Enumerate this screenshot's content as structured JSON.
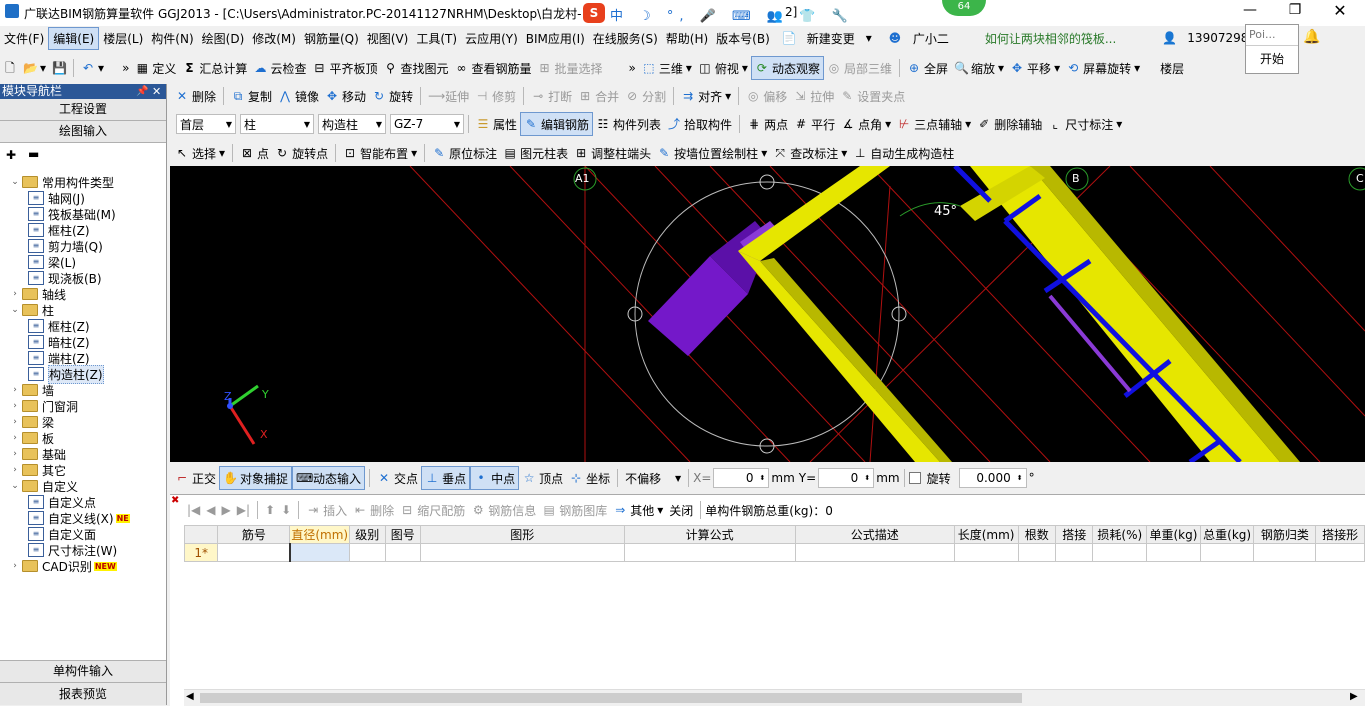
{
  "window": {
    "title": "广联达BIM钢筋算量软件 GGJ2013 - [C:\\Users\\Administrator.PC-20141127NRHM\\Desktop\\白龙村-",
    "title_tail": "2]",
    "ime_badge": "64",
    "popup_input": "Poi...",
    "popup_button": "开始"
  },
  "menu": {
    "items": [
      "文件(F)",
      "编辑(E)",
      "楼层(L)",
      "构件(N)",
      "绘图(D)",
      "修改(M)",
      "钢筋量(Q)",
      "视图(V)",
      "工具(T)",
      "云应用(Y)",
      "BIM应用(I)",
      "在线服务(S)",
      "帮助(H)",
      "版本号(B)"
    ],
    "new_change": "新建变更",
    "assistant": "广小二",
    "question": "如何让两块相邻的筏板...",
    "phone": "13907298339"
  },
  "toolbar1": {
    "define": "定义",
    "sum": "汇总计算",
    "cloud_check": "云检查",
    "flat_top": "平齐板顶",
    "find": "查找图元",
    "view_steel": "查看钢筋量",
    "batch_select": "批量选择",
    "three_d": "三维",
    "top_view": "俯视",
    "dynamic_view": "动态观察",
    "local_3d": "局部三维",
    "full_screen": "全屏",
    "zoom": "缩放",
    "pan": "平移",
    "rotate_screen": "屏幕旋转",
    "floor": "楼层"
  },
  "toolbar2": {
    "items": [
      "删除",
      "复制",
      "镜像",
      "移动",
      "旋转",
      "延伸",
      "修剪",
      "打断",
      "合并",
      "分割",
      "对齐",
      "偏移",
      "拉伸",
      "设置夹点"
    ]
  },
  "toolbar3": {
    "floor": "首层",
    "category": "柱",
    "type": "构造柱",
    "name": "GZ-7",
    "property": "属性",
    "edit_steel": "编辑钢筋",
    "component_list": "构件列表",
    "pick": "拾取构件",
    "two_point": "两点",
    "parallel": "平行",
    "point_angle": "点角",
    "three_point_axis": "三点辅轴",
    "delete_axis": "删除辅轴",
    "dimension": "尺寸标注"
  },
  "toolbar4": {
    "select": "选择",
    "point": "点",
    "rotate_point": "旋转点",
    "smart_layout": "智能布置",
    "origin_label": "原位标注",
    "column_table": "图元柱表",
    "adjust_end": "调整柱端头",
    "draw_by_wall": "按墙位置绘制柱",
    "modify_label": "查改标注",
    "auto_gen": "自动生成构造柱"
  },
  "nav": {
    "title": "模块导航栏",
    "project_setup": "工程设置",
    "drawing_input": "绘图输入",
    "tree": [
      {
        "label": "常用构件类型",
        "level": 0,
        "type": "folder",
        "exp": "-"
      },
      {
        "label": "轴网(J)",
        "level": 1,
        "type": "item"
      },
      {
        "label": "筏板基础(M)",
        "level": 1,
        "type": "item"
      },
      {
        "label": "框柱(Z)",
        "level": 1,
        "type": "item"
      },
      {
        "label": "剪力墙(Q)",
        "level": 1,
        "type": "item"
      },
      {
        "label": "梁(L)",
        "level": 1,
        "type": "item"
      },
      {
        "label": "现浇板(B)",
        "level": 1,
        "type": "item"
      },
      {
        "label": "轴线",
        "level": 0,
        "type": "folder",
        "exp": "+"
      },
      {
        "label": "柱",
        "level": 0,
        "type": "folder",
        "exp": "-"
      },
      {
        "label": "框柱(Z)",
        "level": 1,
        "type": "item"
      },
      {
        "label": "暗柱(Z)",
        "level": 1,
        "type": "item"
      },
      {
        "label": "端柱(Z)",
        "level": 1,
        "type": "item"
      },
      {
        "label": "构造柱(Z)",
        "level": 1,
        "type": "item",
        "selected": true
      },
      {
        "label": "墙",
        "level": 0,
        "type": "folder",
        "exp": "+"
      },
      {
        "label": "门窗洞",
        "level": 0,
        "type": "folder",
        "exp": "+"
      },
      {
        "label": "梁",
        "level": 0,
        "type": "folder",
        "exp": "+"
      },
      {
        "label": "板",
        "level": 0,
        "type": "folder",
        "exp": "+"
      },
      {
        "label": "基础",
        "level": 0,
        "type": "folder",
        "exp": "+"
      },
      {
        "label": "其它",
        "level": 0,
        "type": "folder",
        "exp": "+"
      },
      {
        "label": "自定义",
        "level": 0,
        "type": "folder",
        "exp": "-"
      },
      {
        "label": "自定义点",
        "level": 1,
        "type": "item"
      },
      {
        "label": "自定义线(X)",
        "level": 1,
        "type": "item",
        "new": true
      },
      {
        "label": "自定义面",
        "level": 1,
        "type": "item"
      },
      {
        "label": "尺寸标注(W)",
        "level": 1,
        "type": "item"
      },
      {
        "label": "CAD识别",
        "level": 0,
        "type": "folder",
        "exp": "+",
        "new": true
      }
    ],
    "single_input": "单构件输入",
    "report_preview": "报表预览",
    "new_tag": "NEW",
    "new_tag_short": "NE"
  },
  "canvas": {
    "axis_a1": "A1",
    "axis_b": "B",
    "axis_c": "C",
    "angle": "45°",
    "axis_y": "Y",
    "axis_z": "Z",
    "axis_x": "X"
  },
  "statusbar": {
    "ortho": "正交",
    "snap": "对象捕捉",
    "dynamic_input": "动态输入",
    "intersect": "交点",
    "perpendicular": "垂点",
    "midpoint": "中点",
    "vertex": "顶点",
    "coord": "坐标",
    "offset_mode": "不偏移",
    "x_label": "X=",
    "x_value": "0",
    "mm1": "mm",
    "y_label": "Y=",
    "y_value": "0",
    "mm2": "mm",
    "rotate": "旋转",
    "rotate_value": "0.000",
    "degree": "°"
  },
  "rebar_toolbar": {
    "insert": "插入",
    "delete": "删除",
    "scale": "缩尺配筋",
    "info": "钢筋信息",
    "library": "钢筋图库",
    "other": "其他",
    "close": "关闭",
    "total": "单构件钢筋总重(kg)：0"
  },
  "grid": {
    "headers": [
      "筋号",
      "直径(mm)",
      "级别",
      "图号",
      "图形",
      "计算公式",
      "公式描述",
      "长度(mm)",
      "根数",
      "搭接",
      "损耗(%)",
      "单重(kg)",
      "总重(kg)",
      "钢筋归类",
      "搭接形"
    ],
    "row_label": "1*"
  }
}
